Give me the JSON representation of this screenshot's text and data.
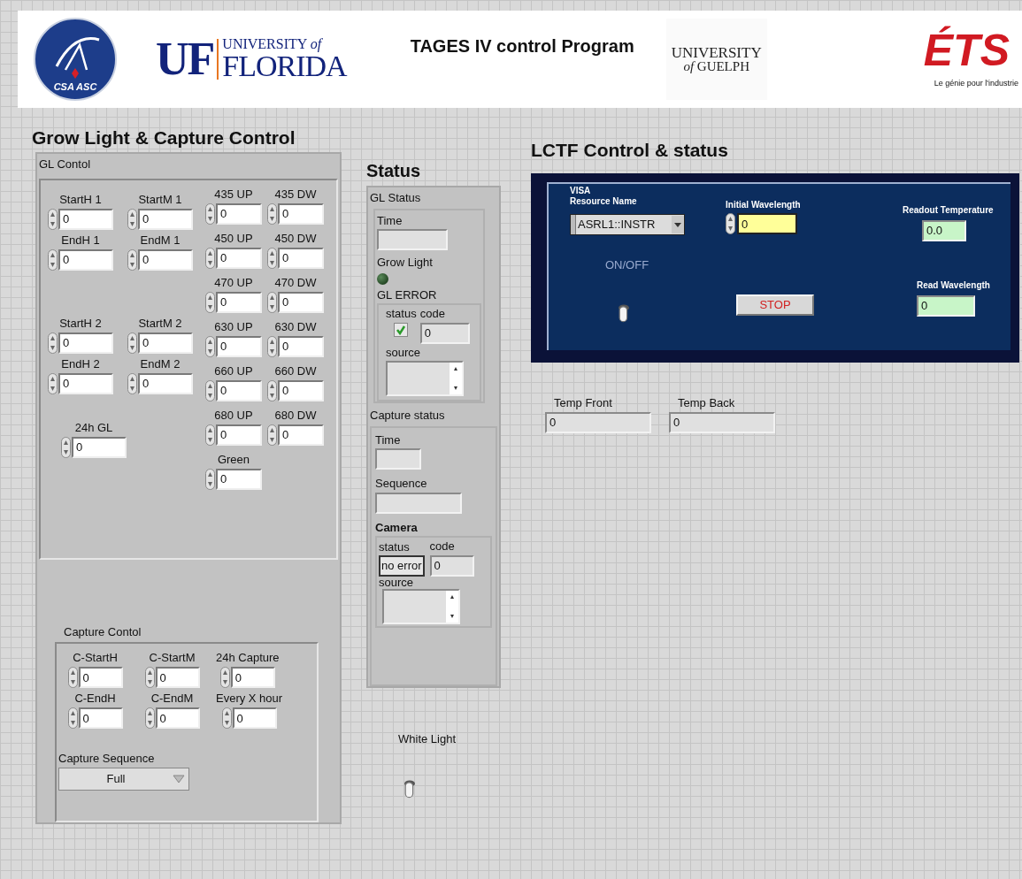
{
  "header": {
    "csa_logo": "CSA ASC",
    "uf_logo": {
      "mark": "UF",
      "line1": "UNIVERSITY *of*",
      "line2": "FLORIDA"
    },
    "title": "TAGES IV control Program",
    "guelph_logo": {
      "line1": "UNIVERSITY",
      "line2": "*of* GUELPH"
    },
    "ets_logo": {
      "mark": "ÉTS",
      "tagline": "Le génie pour l'industrie"
    }
  },
  "grow_light": {
    "title": "Grow Light & Capture Control",
    "gl_panel": {
      "label": "GL Contol",
      "left_groups": [
        [
          {
            "label": "StartH 1",
            "value": "0"
          },
          {
            "label": "StartM 1",
            "value": "0"
          },
          {
            "label": "EndH 1",
            "value": "0"
          },
          {
            "label": "EndM 1",
            "value": "0"
          }
        ],
        [
          {
            "label": "StartH 2",
            "value": "0"
          },
          {
            "label": "StartM 2",
            "value": "0"
          },
          {
            "label": "EndH 2",
            "value": "0"
          },
          {
            "label": "EndM 2",
            "value": "0"
          }
        ],
        [
          {
            "label": "24h GL",
            "value": "0"
          }
        ]
      ],
      "right_rows": [
        [
          {
            "label": "435 UP",
            "value": "0"
          },
          {
            "label": "435 DW",
            "value": "0"
          }
        ],
        [
          {
            "label": "450 UP",
            "value": "0"
          },
          {
            "label": "450 DW",
            "value": "0"
          }
        ],
        [
          {
            "label": "470 UP",
            "value": "0"
          },
          {
            "label": "470 DW",
            "value": "0"
          }
        ],
        [
          {
            "label": "630 UP",
            "value": "0"
          },
          {
            "label": "630 DW",
            "value": "0"
          }
        ],
        [
          {
            "label": "660 UP",
            "value": "0"
          },
          {
            "label": "660 DW",
            "value": "0"
          }
        ],
        [
          {
            "label": "680 UP",
            "value": "0"
          },
          {
            "label": "680 DW",
            "value": "0"
          }
        ],
        [
          {
            "label": "Green",
            "value": "0"
          }
        ]
      ]
    },
    "capture": {
      "label": "Capture Contol",
      "time_controls": [
        {
          "label": "C-StartH",
          "value": "0"
        },
        {
          "label": "C-StartM",
          "value": "0"
        },
        {
          "label": "C-EndH",
          "value": "0"
        },
        {
          "label": "C-EndM",
          "value": "0"
        }
      ],
      "side_controls": [
        {
          "label": "24h Capture",
          "value": "0"
        },
        {
          "label": "Every X hour",
          "value": "0"
        }
      ],
      "sequence": {
        "label": "Capture Sequence",
        "value": "Full"
      }
    }
  },
  "status": {
    "title": "Status",
    "gl_status": {
      "label": "GL Status",
      "time_label": "Time",
      "indicator_label": "Grow Light",
      "on": false,
      "error": {
        "label": "GL ERROR",
        "status_label": "status",
        "status_ok": true,
        "code_label": "code",
        "code": "0",
        "source_label": "source"
      }
    },
    "capture_status": {
      "label": "Capture status",
      "time_label": "Time",
      "sequence_label": "Sequence",
      "camera": {
        "label": "Camera",
        "status_label": "status",
        "status_text": "no error",
        "code_label": "code",
        "code": "0",
        "source_label": "source"
      }
    }
  },
  "white_light": {
    "label": "White Light",
    "on": false
  },
  "lctf": {
    "title": "LCTF Control & status",
    "visa": {
      "line1": "VISA",
      "line2": "Resource Name",
      "value": "ASRL1::INSTR"
    },
    "initial_wavelength": {
      "label": "Initial Wavelength",
      "value": "0"
    },
    "readout_temperature": {
      "label": "Readout Temperature",
      "value": "0.0"
    },
    "switch": {
      "label": "ON/OFF",
      "on": false
    },
    "stop": "STOP",
    "read_wavelength": {
      "label": "Read Wavelength",
      "value": "0"
    },
    "temps": [
      {
        "label": "Temp Front",
        "value": "0"
      },
      {
        "label": "Temp Back",
        "value": "0"
      }
    ]
  }
}
